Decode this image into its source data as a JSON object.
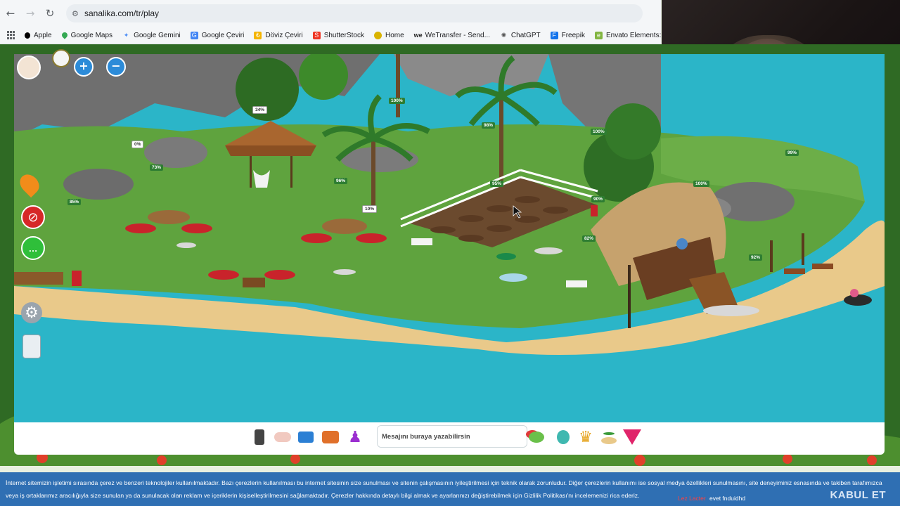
{
  "browser": {
    "url": "sanalika.com/tr/play",
    "bookmarks": [
      {
        "label": "Apple",
        "icon": "apple-icon",
        "color": "#000000"
      },
      {
        "label": "Google Maps",
        "icon": "maps-pin-icon",
        "color": "#34a853"
      },
      {
        "label": "Google Gemini",
        "icon": "gemini-star-icon",
        "color": "#4c8df6"
      },
      {
        "label": "Google Çeviri",
        "icon": "translate-icon",
        "color": "#4285f4"
      },
      {
        "label": "Döviz Çeviri",
        "icon": "currency-icon",
        "color": "#f4b400"
      },
      {
        "label": "ShutterStock",
        "icon": "shutterstock-icon",
        "color": "#ee3524"
      },
      {
        "label": "Home",
        "icon": "home-circle-icon",
        "color": "#d9b300"
      },
      {
        "label": "WeTransfer - Send...",
        "icon": "wetransfer-icon",
        "color": "#222222"
      },
      {
        "label": "ChatGPT",
        "icon": "chatgpt-icon",
        "color": "#555555"
      },
      {
        "label": "Freepik",
        "icon": "freepik-icon",
        "color": "#1273eb"
      },
      {
        "label": "Envato Elements:...",
        "icon": "envato-icon",
        "color": "#82b541"
      }
    ]
  },
  "game": {
    "chat_placeholder": "Mesajını buraya yazabilirsin",
    "percent_labels": [
      "34%",
      "100%",
      "98%",
      "100%",
      "99%",
      "0%",
      "73%",
      "96%",
      "85%",
      "10%",
      "95%",
      "90%",
      "100%",
      "82%",
      "92%"
    ]
  },
  "cookie_banner": {
    "text": "İnternet sitemizin işletimi sırasında çerez ve benzeri teknolojiler kullanılmaktadır. Bazı çerezlerin kullanılması bu internet sitesinin size sunulması ve sitenin çalışmasının iyileştirilmesi için teknik olarak zorunludur. Diğer çerezlerin kullanımı ise sosyal medya özellikleri sunulmasını, site deneyiminiz esnasında ve takiben tarafımızca veya iş ortaklarımız aracılığıyla size sunulan ya da sunulacak olan reklam ve içeriklerin kişiselleştirilmesini sağlamaktadır. Çerezler hakkında detaylı bilgi almak ve ayarlarınızı değiştirebilmek için Gizlilik Politikası'nı incelemenizi rica ederiz.",
    "red_text": "Lez Lacter",
    "extra_text": "evet fnduidhd",
    "accept_label": "KABUL ET"
  },
  "colors": {
    "sea": "#2bb5c8",
    "grass": "#5fa33e",
    "sand": "#e9c98a",
    "banner": "#2f6fb3"
  }
}
